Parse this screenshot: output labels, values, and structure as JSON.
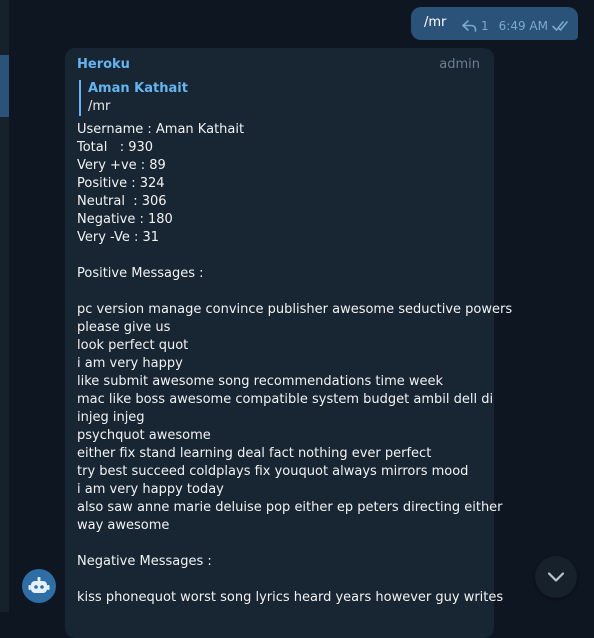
{
  "outgoing": {
    "text": "/mr",
    "reply_count": "1",
    "time": "6:49 AM",
    "icons": [
      "reply-icon",
      "double-check-icon"
    ]
  },
  "incoming": {
    "sender": "Heroku",
    "role": "admin",
    "quote": {
      "name": "Aman Kathait",
      "text": "/mr"
    },
    "lines": [
      "Username : Aman Kathait",
      "Total   : 930",
      "Very +ve : 89",
      "Positive : 324",
      "Neutral  : 306",
      "Negative : 180",
      "Very -Ve : 31",
      "",
      "Positive Messages :",
      "",
      "pc version manage convince publisher awesome seductive powers",
      "please give us",
      "look perfect quot",
      "i am very happy",
      "like submit awesome song recommendations time week",
      "mac like boss awesome compatible system budget ambil dell di",
      "injeg injeg",
      "psychquot awesome",
      "either fix stand learning deal fact nothing ever perfect",
      "try best succeed coldplays fix youquot always mirrors mood",
      "i am very happy today",
      "also saw anne marie deluise pop either ep peters directing either",
      "way awesome",
      "",
      "Negative Messages :",
      "",
      "kiss phonequot worst song lyrics heard years however guy writes"
    ]
  },
  "buttons": {
    "bot_icon": "bot-icon",
    "scroll_icon": "chevron-down-icon"
  },
  "colors": {
    "background": "#0e1621",
    "outgoing_bubble": "#2b5278",
    "incoming_bubble": "#182533",
    "accent": "#64b5ef"
  }
}
